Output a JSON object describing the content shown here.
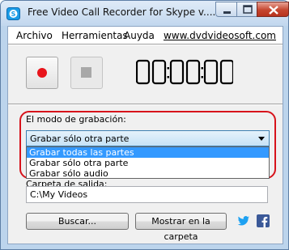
{
  "window": {
    "title": "Free Video Call Recorder for Skype v...."
  },
  "menubar": {
    "items": [
      "Archivo",
      "Herramientas",
      "Auyda"
    ],
    "link": "www.dvdvideosoft.com"
  },
  "timer": {
    "digits": [
      "0",
      "0",
      "0",
      "0",
      "0",
      "0"
    ]
  },
  "recording_mode": {
    "label": "El modo de grabación:",
    "selected": "Grabar sólo otra parte",
    "options": [
      "Grabar todas las partes",
      "Grabar sólo otra parte",
      "Grabar sólo audio"
    ],
    "highlighted_index": 0
  },
  "output_folder": {
    "label_partial": "Carpeta de salida:",
    "value": "C:\\My Videos"
  },
  "buttons": {
    "browse": "Buscar...",
    "show_folder": "Mostrar en la carpeta"
  },
  "colors": {
    "record_red": "#e8141b",
    "highlight": "#d7131b",
    "selection": "#3399ff",
    "twitter": "#1da1f2",
    "facebook": "#3b5998"
  }
}
